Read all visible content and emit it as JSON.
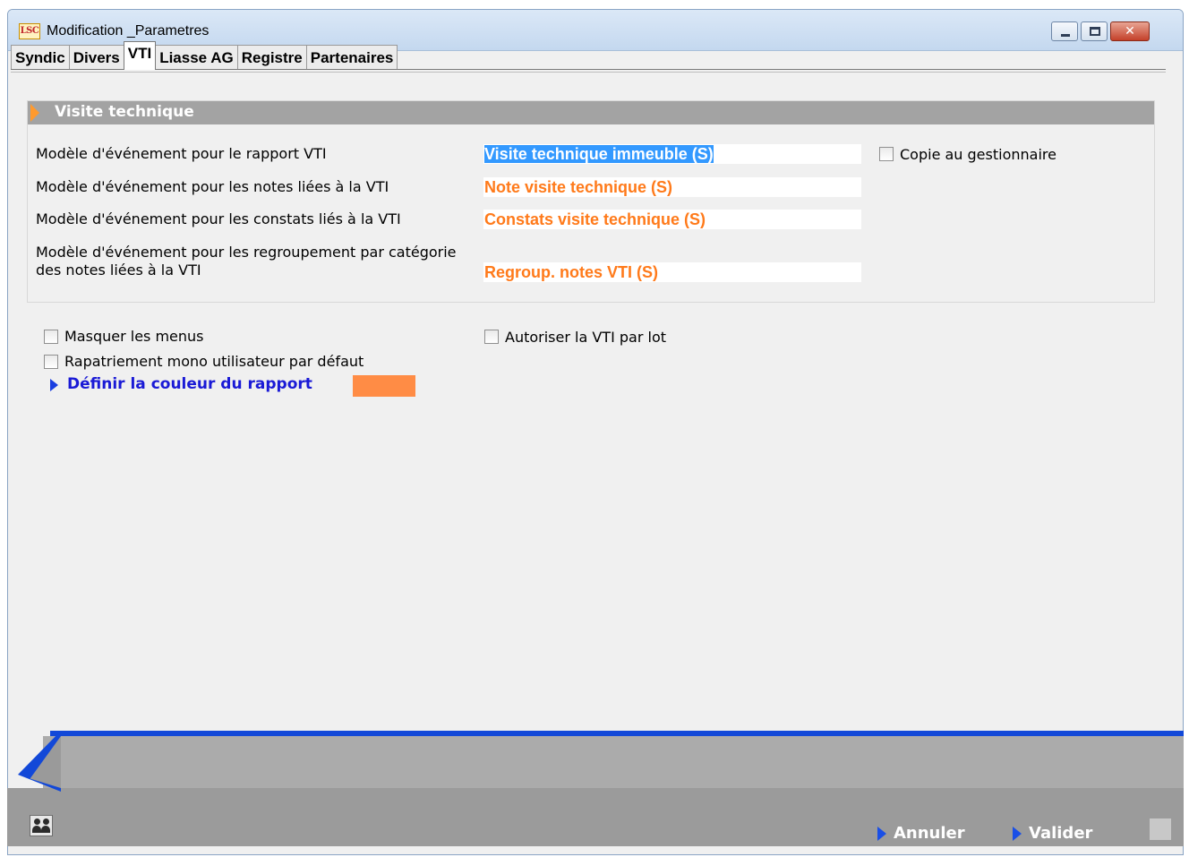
{
  "window": {
    "app_logo": "LSC",
    "title": "Modification _Parametres",
    "close_glyph": "✕"
  },
  "tabs": [
    {
      "label": "Syndic"
    },
    {
      "label": "Divers"
    },
    {
      "label": "VTI",
      "active": true
    },
    {
      "label": "Liasse AG"
    },
    {
      "label": "Registre"
    },
    {
      "label": "Partenaires"
    }
  ],
  "section": {
    "title": "Visite technique",
    "rows": [
      {
        "label": "Modèle d'événement pour le rapport VTI",
        "value": "Visite technique immeuble (S)",
        "selected": true
      },
      {
        "label": "Modèle d'événement pour les notes liées à la VTI",
        "value": "Note visite technique (S)"
      },
      {
        "label": "Modèle d'événement pour les constats liés à la VTI",
        "value": "Constats visite technique (S)"
      },
      {
        "label_line1": "Modèle d'événement pour les regroupement par catégorie",
        "label_line2": "des notes liées à la VTI",
        "value": "Regroup. notes VTI (S)"
      }
    ],
    "copy_checkbox": {
      "label": "Copie au gestionnaire",
      "checked": false
    }
  },
  "options": {
    "hide_menus": {
      "label": "Masquer les menus",
      "checked": false
    },
    "mono_user": {
      "label": "Rapatriement mono utilisateur par défaut",
      "checked": false
    },
    "vti_by_lot": {
      "label": "Autoriser la VTI par lot",
      "checked": false
    }
  },
  "report_color": {
    "link_label": "Définir la couleur du rapport",
    "color": "#ff8c45"
  },
  "footer": {
    "cancel_label": "Annuler",
    "validate_label": "Valider"
  },
  "colors": {
    "field_text": "#ff7a1a",
    "accent_blue": "#1248d8",
    "section_header": "#a3a3a3",
    "link": "#1a1ad6"
  },
  "icons": {
    "users": "users-icon",
    "chevron": "chevron-right-icon",
    "arrow_back": "back-arrow-icon"
  }
}
